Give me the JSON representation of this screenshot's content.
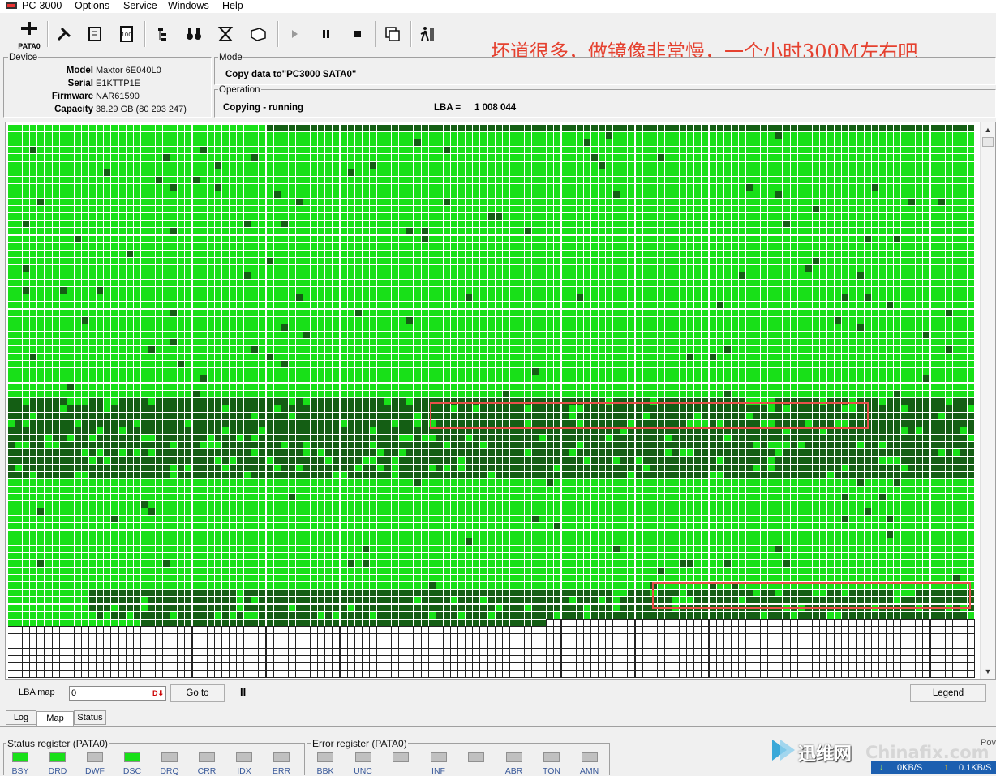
{
  "app": {
    "title": "PC-3000",
    "menu": [
      "Options",
      "Service",
      "Windows",
      "Help"
    ]
  },
  "toolbar": {
    "active_label": "PATA0",
    "icons": [
      "port-icon",
      "tools-icon",
      "scroll-icon",
      "test-icon",
      "percent-icon",
      "tree-icon",
      "binoculars-icon",
      "press-icon",
      "drive-icon",
      "play-icon",
      "pause-icon",
      "stop-icon",
      "copy-icon",
      "exit-icon"
    ]
  },
  "annotation": "坏道很多，做镜像非常慢，一个小时300M左右吧",
  "device": {
    "title": "Device",
    "rows": [
      {
        "label": "Model",
        "value": "Maxtor 6E040L0"
      },
      {
        "label": "Serial",
        "value": "E1KTTP1E"
      },
      {
        "label": "Firmware",
        "value": "NAR61590"
      },
      {
        "label": "Capacity",
        "value": "38.29 GB (80 293 247)"
      }
    ]
  },
  "mode": {
    "title": "Mode",
    "text": "Copy data to\"PC3000 SATA0\""
  },
  "operation": {
    "title": "Operation",
    "status": "Copying - running",
    "lba_label": "LBA =",
    "lba_value": "1 008 044"
  },
  "colors": {
    "bright": "#18e018",
    "dark": "#145e14",
    "empty": "#ffffff",
    "highlight": "#e8504a",
    "led_on": "#18e018",
    "led_off": "#c0c0c0"
  },
  "bottom": {
    "lba_map_label": "LBA map",
    "lba_input": "0",
    "goto_label": "Go to",
    "pause_symbol": "II",
    "legend_label": "Legend",
    "tabs": [
      "Log",
      "Map",
      "Status"
    ],
    "active_tab": "Map"
  },
  "status_register": {
    "title": "Status register (PATA0)",
    "leds": [
      {
        "name": "BSY",
        "on": true
      },
      {
        "name": "DRD",
        "on": true
      },
      {
        "name": "DWF",
        "on": false
      },
      {
        "name": "DSC",
        "on": true
      },
      {
        "name": "DRQ",
        "on": false
      },
      {
        "name": "CRR",
        "on": false
      },
      {
        "name": "IDX",
        "on": false
      },
      {
        "name": "ERR",
        "on": false
      }
    ]
  },
  "error_register": {
    "title": "Error register (PATA0)",
    "leds": [
      {
        "name": "BBK",
        "on": false
      },
      {
        "name": "UNC",
        "on": false
      },
      {
        "name": "",
        "on": false
      },
      {
        "name": "INF",
        "on": false
      },
      {
        "name": "",
        "on": false
      },
      {
        "name": "ABR",
        "on": false
      },
      {
        "name": "TON",
        "on": false
      },
      {
        "name": "AMN",
        "on": false
      }
    ]
  },
  "watermark": {
    "brand_cn": "迅维网",
    "brand_en": "Chinafix.com",
    "down_speed": "0KB/S",
    "up_speed": "0.1KB/S",
    "side_label": "Pov"
  }
}
